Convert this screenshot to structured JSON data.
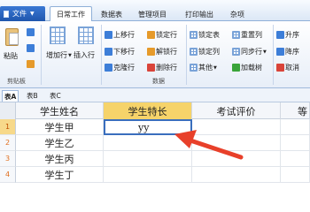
{
  "menu": {
    "file_label": "文件",
    "tabs": [
      "日常工作",
      "数据表",
      "管理项目",
      "打印输出",
      "杂项"
    ]
  },
  "ribbon": {
    "clipboard": {
      "paste": "粘贴",
      "group": "剪贴板"
    },
    "insert": {
      "add_row": "增加行",
      "insert_row": "插入行"
    },
    "rows": {
      "up": "上移行",
      "down": "下移行",
      "copy": "克隆行",
      "group": "数据"
    },
    "locks": {
      "lock_row": "锁定行",
      "unlock_row": "解锁行",
      "delete_row": "删除行"
    },
    "tables": {
      "lock_table": "锁定表",
      "lock_col": "锁定列",
      "other": "其他"
    },
    "cols": {
      "reorder": "重置列",
      "sync": "同步行",
      "load_tree": "加载树"
    },
    "sort": {
      "asc": "升序",
      "desc": "降序",
      "cancel": "取消"
    }
  },
  "sheets": [
    "表A",
    "表B",
    "表C"
  ],
  "columns": [
    "学生姓名",
    "学生特长",
    "考试评价",
    "等"
  ],
  "rows": [
    {
      "num": "1",
      "name": "学生甲",
      "skill": "yy"
    },
    {
      "num": "2",
      "name": "学生乙",
      "skill": ""
    },
    {
      "num": "3",
      "name": "学生丙",
      "skill": ""
    },
    {
      "num": "4",
      "name": "学生丁",
      "skill": ""
    }
  ],
  "colors": {
    "accent": "#1f56ad",
    "selected_header": "#f6d36a",
    "arrow": "#e8402a"
  }
}
